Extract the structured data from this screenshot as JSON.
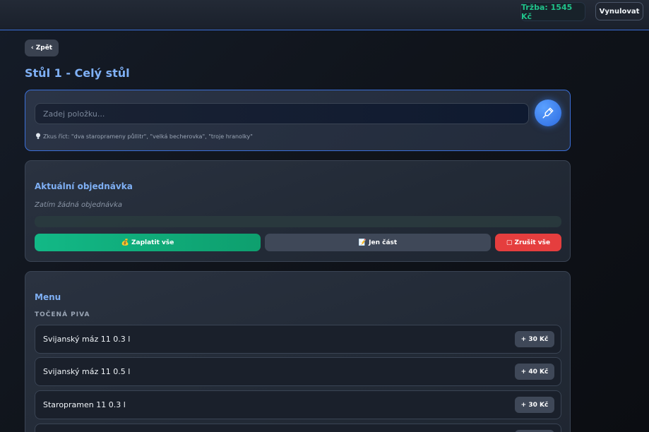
{
  "header": {
    "revenue_label": "Tržba: 1545 Kč",
    "reset_label": "Vynulovat"
  },
  "nav": {
    "back_label": "‹ Zpět"
  },
  "page": {
    "title": "Stůl 1 - Celý stůl"
  },
  "input": {
    "placeholder": "Zadej položku...",
    "hint_icon": "lightbulb-icon",
    "hint": "Zkus říct: \"dva staroprameny půllitr\", \"velká becherovka\", \"troje hranolky\"",
    "voice_icon": "microphone-icon"
  },
  "order": {
    "title": "Aktuální objednávka",
    "empty": "Zatím žádná objednávka",
    "pay_all_label": "💰 Zaplatit vše",
    "part_label": "📝 Jen část",
    "cancel_label": "▢ Zrušit vše"
  },
  "menu": {
    "title": "Menu",
    "category": "TOČENÁ PIVA",
    "items": [
      {
        "name": "Svijanský máz 11 0.3 l",
        "price": "+ 30 Kč"
      },
      {
        "name": "Svijanský máz 11 0.5 l",
        "price": "+ 40 Kč"
      },
      {
        "name": "Staropramen 11 0.3 l",
        "price": "+ 30 Kč"
      },
      {
        "name": "",
        "price": ""
      }
    ]
  },
  "colors": {
    "accent": "#7fb0f5",
    "success": "#12b886",
    "danger": "#e53e3e",
    "border_focus": "#3b6fd8"
  }
}
